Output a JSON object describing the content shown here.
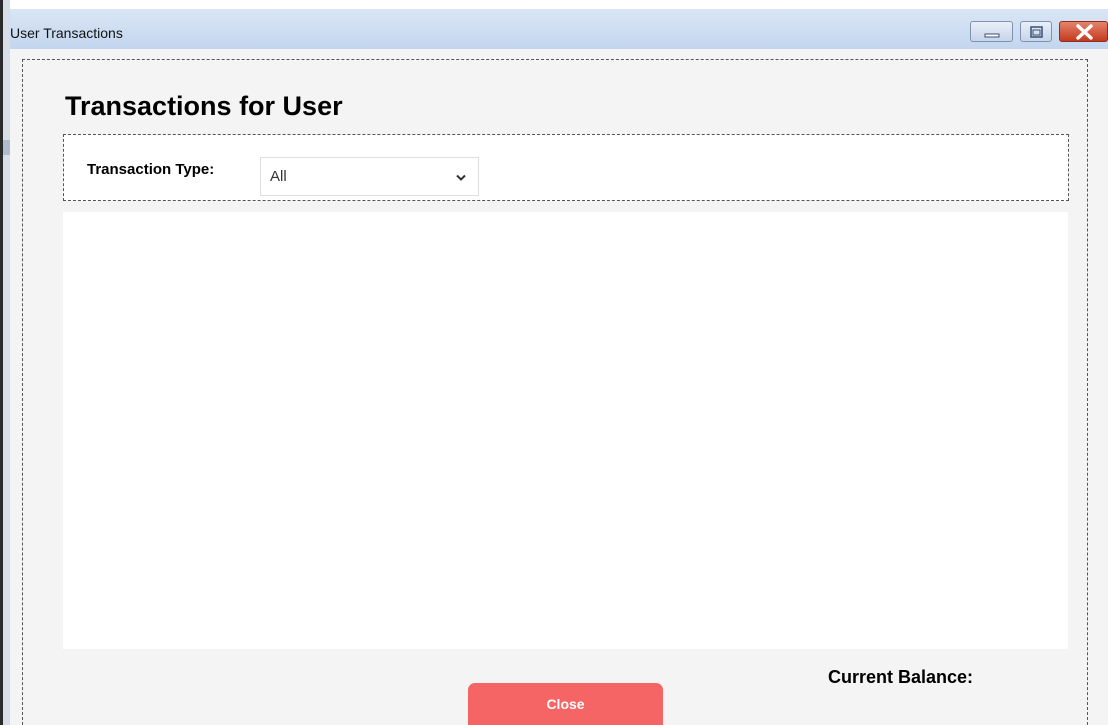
{
  "window": {
    "title": "User Transactions",
    "controls": {
      "minimize_icon": "minimize-icon",
      "maximize_icon": "maximize-icon",
      "close_icon": "close-icon",
      "close_color": "#c33a1d"
    }
  },
  "page": {
    "title": "Transactions for User"
  },
  "filter": {
    "label": "Transaction Type:",
    "selected": "All",
    "icon": "chevron-down-icon"
  },
  "transactions": {
    "rows": []
  },
  "footer": {
    "balance_label": "Current Balance:",
    "close_label": "Close",
    "close_color": "#f56565"
  }
}
